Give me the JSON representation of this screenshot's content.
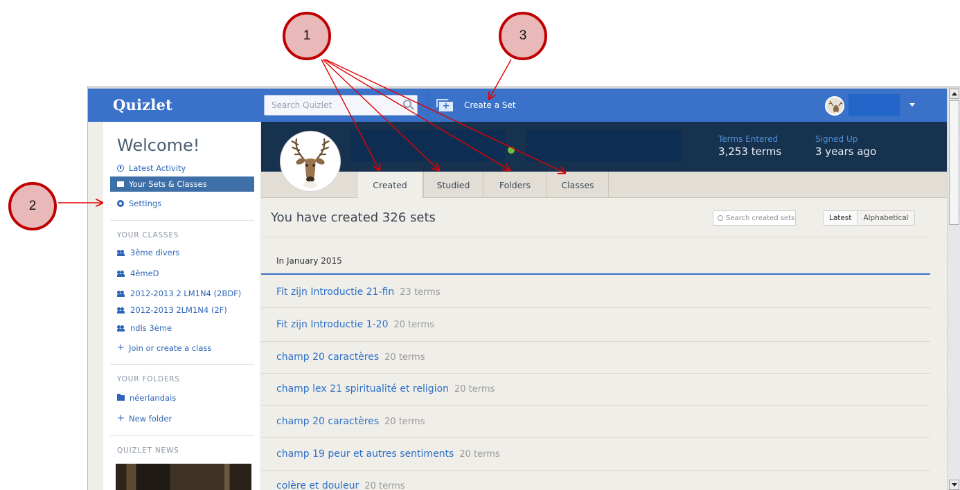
{
  "callouts": {
    "one": "1",
    "two": "2",
    "three": "3"
  },
  "navbar": {
    "logo": "Quizlet",
    "search_placeholder": "Search Quizlet",
    "create_set": "Create a Set"
  },
  "sidebar": {
    "welcome": "Welcome!",
    "nav": [
      {
        "label": "Latest Activity",
        "icon": "clock-icon"
      },
      {
        "label": "Your Sets & Classes",
        "icon": "card-icon",
        "active": true
      },
      {
        "label": "Settings",
        "icon": "gear-icon"
      }
    ],
    "classes_heading": "YOUR CLASSES",
    "classes": [
      "3ème divers",
      "4èmeD",
      "2012-2013 2 LM1N4 (2BDF)",
      "2012-2013 2LM1N4 (2F)",
      "ndls 3ème"
    ],
    "join_class": "Join or create a class",
    "folders_heading": "YOUR FOLDERS",
    "folders": [
      "néerlandais"
    ],
    "new_folder": "New folder",
    "news_heading": "QUIZLET NEWS"
  },
  "profile": {
    "terms_label": "Terms Entered",
    "terms_value": "3,253 terms",
    "signup_label": "Signed Up",
    "signup_value": "3 years ago"
  },
  "tabs": [
    "Created",
    "Studied",
    "Folders",
    "Classes"
  ],
  "main": {
    "title": "You have created 326 sets",
    "filter_placeholder": "Search created sets",
    "sort_latest": "Latest",
    "sort_alpha": "Alphabetical",
    "month": "In January 2015",
    "sets": [
      {
        "title": "Fit zijn Introductie 21-fin",
        "count": "23 terms"
      },
      {
        "title": "Fit zijn Introductie 1-20",
        "count": "20 terms"
      },
      {
        "title": "champ 20 caractères",
        "count": "20 terms"
      },
      {
        "title": "champ lex 21 spiritualité et religion",
        "count": "20 terms"
      },
      {
        "title": "champ 20 caractères",
        "count": "20 terms"
      },
      {
        "title": "champ 19 peur et autres sentiments",
        "count": "20 terms"
      },
      {
        "title": "colère et douleur",
        "count": "20 terms"
      }
    ]
  },
  "colors": {
    "brand_blue": "#3a72c9",
    "header_navy": "#17324f",
    "callout_fill": "#e8b9b8",
    "callout_ring": "#c00000"
  }
}
